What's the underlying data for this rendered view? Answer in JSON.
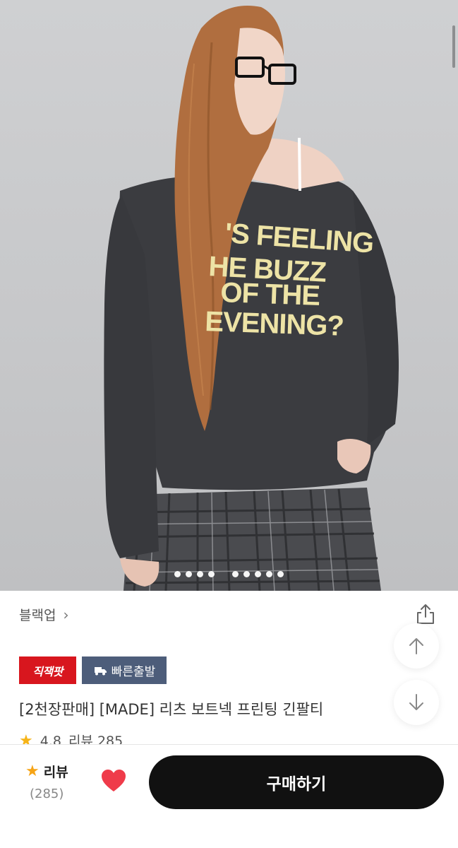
{
  "hero": {
    "image_desc": "model wearing dark off-shoulder printed long sleeve tee",
    "print_text": [
      "'S FEELING",
      "HE BUZZ",
      "OF THE",
      "EVENING?"
    ],
    "carousel_dots": 9,
    "carousel_active": 0
  },
  "brand": {
    "name": "블랙업",
    "chevron": "›"
  },
  "icons": {
    "share": "share-icon",
    "scroll_up": "arrow-up-icon",
    "scroll_down": "arrow-down-icon",
    "heart": "heart-icon",
    "star": "star-icon",
    "truck": "truck-icon"
  },
  "badges": {
    "red": "직잭팟",
    "blue": "빠른출발"
  },
  "product": {
    "title": "[2천장판매] [MADE] 리츠 보트넥 프린팅 긴팔티"
  },
  "rating_peek": {
    "score": "4.8",
    "label": "리뷰 285"
  },
  "bottom": {
    "review_label": "리뷰",
    "review_count": "(285)",
    "buy_label": "구매하기"
  },
  "colors": {
    "badge_red": "#d8161e",
    "badge_blue": "#4d5d7a",
    "buy_bg": "#111111",
    "heart": "#ef3b4a",
    "star": "#f6a416"
  }
}
